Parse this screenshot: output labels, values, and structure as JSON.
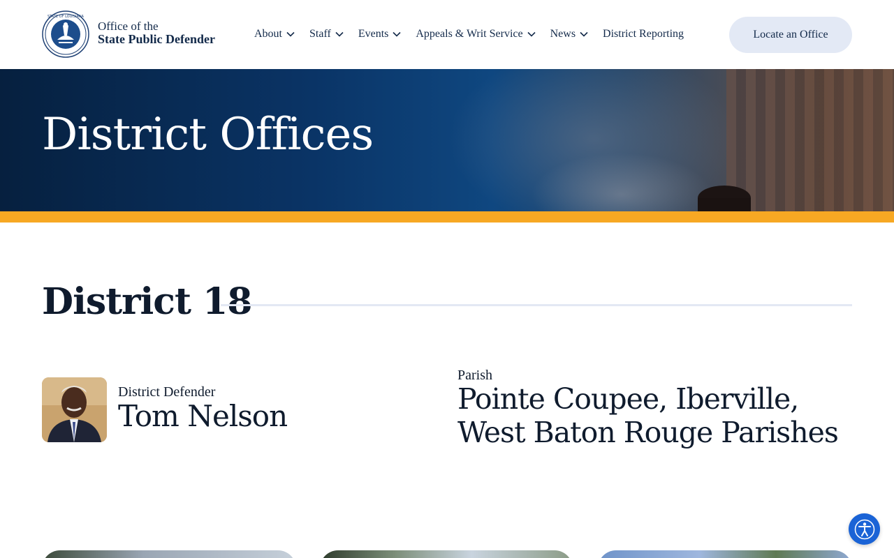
{
  "header": {
    "logo_icon": "louisiana-state-seal",
    "brand_line1": "Office of the",
    "brand_line2": "State Public Defender",
    "nav": [
      {
        "label": "About",
        "has_dropdown": true
      },
      {
        "label": "Staff",
        "has_dropdown": true
      },
      {
        "label": "Events",
        "has_dropdown": true
      },
      {
        "label": "Appeals & Writ Service",
        "has_dropdown": true
      },
      {
        "label": "News",
        "has_dropdown": true
      },
      {
        "label": "District Reporting",
        "has_dropdown": false
      }
    ],
    "cta_label": "Locate an Office"
  },
  "hero": {
    "title": "District Offices",
    "image_icon": "gavel-image",
    "accent_color": "#f7a823"
  },
  "district": {
    "title": "District 18",
    "defender_label": "District Defender",
    "defender_name": "Tom Nelson",
    "defender_photo_icon": "portrait-photo",
    "parish_label": "Parish",
    "parish_name": "Pointe Coupee, Iberville, West Baton Rouge Parishes"
  },
  "accessibility_button_icon": "accessibility-icon",
  "colors": {
    "navy": "#132a4a",
    "button_bg": "#e3e9f5",
    "accessibility_blue": "#1a63d6"
  }
}
